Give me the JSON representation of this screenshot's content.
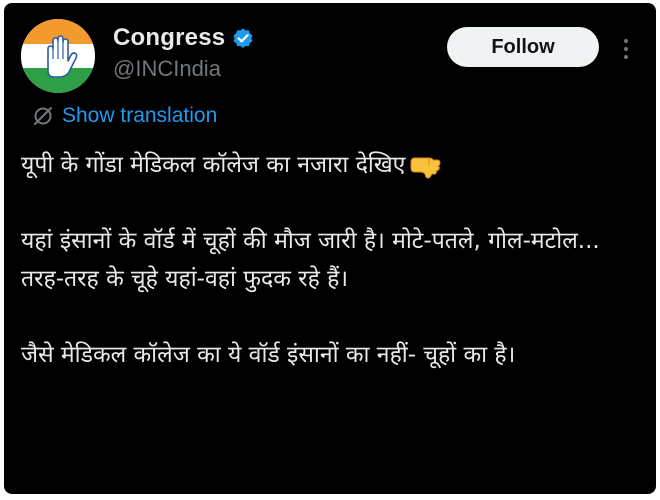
{
  "author": {
    "display_name": "Congress",
    "handle": "@INCIndia",
    "verified": true,
    "avatar_icon": "congress-hand-logo",
    "verified_icon": "verified-badge-icon"
  },
  "actions": {
    "follow_label": "Follow",
    "more_icon": "more-options-icon"
  },
  "translation": {
    "label": "Show translation",
    "icon": "translate-icon"
  },
  "tweet": {
    "paragraphs": [
      "यूपी के गोंडा मेडिकल कॉलेज का नजारा देखिए",
      "यहां इंसानों के वॉर्ड में चूहों की मौज जारी है। मोटे-पतले, गोल-मटोल... तरह-तरह के चूहे यहां-वहां फुदक रहे हैं।",
      "जैसे मेडिकल कॉलेज का ये वॉर्ड इंसानों का नहीं- चूहों का है।"
    ],
    "emoji": "pointing-down-hand-emoji"
  },
  "colors": {
    "background": "#000000",
    "text_primary": "#e7e9ea",
    "text_secondary": "#71767b",
    "link": "#1d9bf0",
    "verified": "#1d9bf0",
    "follow_bg": "#eff3f4",
    "saffron": "#f39a2e",
    "green": "#2e9e47"
  }
}
